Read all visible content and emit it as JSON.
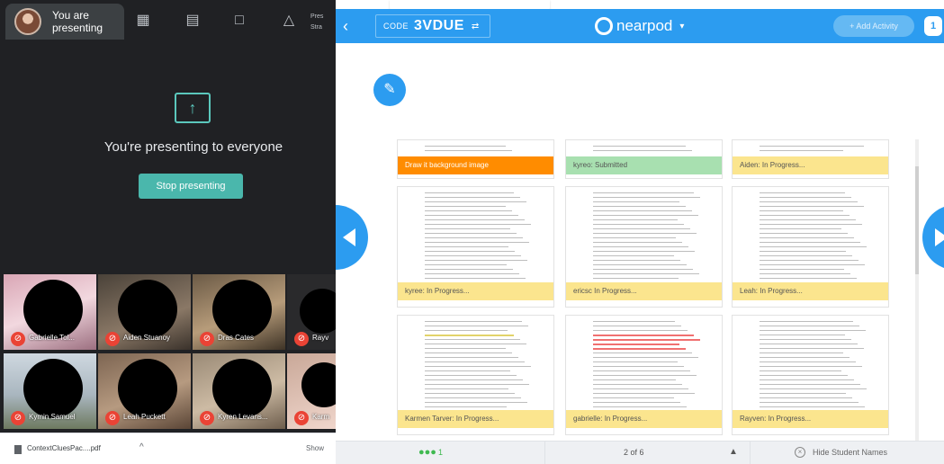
{
  "meet": {
    "presenting_line1": "You are",
    "presenting_line2": "presenting",
    "toolbar_icons": [
      "grid-icon",
      "captions-icon",
      "chat-icon",
      "people-icon"
    ],
    "present_label_line1": "Pres",
    "present_label_line2": "Stra",
    "presenting_to": "You're presenting to everyone",
    "stop_button": "Stop presenting",
    "participants": [
      {
        "name": "Gabrielle Tol..."
      },
      {
        "name": "Aiden Stuanoy"
      },
      {
        "name": "Dras Cates"
      },
      {
        "name": "Rayv"
      },
      {
        "name": "Kymin Samuel"
      },
      {
        "name": "Leah Puckett"
      },
      {
        "name": "Kyren Levans..."
      },
      {
        "name": "Karm"
      }
    ],
    "download": {
      "filename": "ContextCluesPac....pdf",
      "chevron": "^",
      "show_all": "Show"
    }
  },
  "nearpod": {
    "code_label": "CODE",
    "code_value": "3VDUE",
    "code_expand": "⇄",
    "logo_text": "nearpod",
    "logo_chevron": "▾",
    "add_activity": "+ Add Activity",
    "header_badge": "1",
    "cards": [
      {
        "label": "Draw it background image",
        "status": "orange"
      },
      {
        "label": "kyreo: Submitted",
        "status": "green"
      },
      {
        "label": "Aiden: In Progress...",
        "status": "yellow"
      },
      {
        "label": "kyree: In Progress...",
        "status": "yellow"
      },
      {
        "label": "ericsc In Progress...",
        "status": "yellow"
      },
      {
        "label": "Leah: In Progress...",
        "status": "yellow"
      },
      {
        "label": "Karmen Tarver: In Progress...",
        "status": "yellow"
      },
      {
        "label": "gabrielle: In Progress...",
        "status": "yellow"
      },
      {
        "label": "Rayven: In Progress...",
        "status": "yellow"
      }
    ],
    "footer": {
      "students_count": "1",
      "page_indicator": "2 of 6",
      "page_up": "▲",
      "hide_names": "Hide Student Names"
    }
  },
  "colors": {
    "nearpod_blue": "#2c9cf0",
    "meet_dark": "#202124",
    "stop_teal": "#4ab7ac",
    "status_yellow": "#fbe58e",
    "status_green": "#a8e0b0",
    "status_orange": "#ff8c00"
  }
}
